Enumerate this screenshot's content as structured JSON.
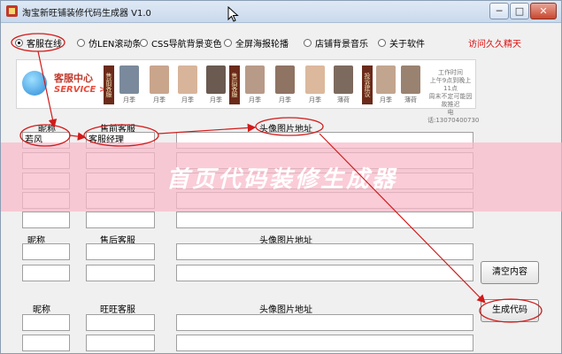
{
  "window": {
    "title": "淘宝新旺铺装修代码生成器 V1.0"
  },
  "titlebar_buttons": {
    "minimize": "─",
    "maximize": "□",
    "close": "✕"
  },
  "radios": [
    {
      "label": "客服在线",
      "selected": true
    },
    {
      "label": "仿LEN滚动条",
      "selected": false
    },
    {
      "label": "CSS导航背景变色",
      "selected": false
    },
    {
      "label": "全屏海报轮播",
      "selected": false
    },
    {
      "label": "店铺背景音乐",
      "selected": false
    },
    {
      "label": "关于软件",
      "selected": false
    }
  ],
  "visit_link": "访问久久精天",
  "preview": {
    "title": "客服中心",
    "subtitle": "SERVICE >",
    "presale_chip": "售前客服",
    "aftersale_chip": "售后客服",
    "consult_chip": "投诉建议",
    "avatar_labels": [
      "月季",
      "月季",
      "月季",
      "月季",
      "月季",
      "月季",
      "月季",
      "薄荷",
      "月季",
      "薄荷"
    ],
    "info_lines": [
      "工作时间",
      "上午9点到晚上11点",
      "周末不定可能因故推迟",
      "电话:13070400730"
    ]
  },
  "section1": {
    "nickname_header": "昵称",
    "role_header": "售前客服",
    "avatar_header": "头像图片地址",
    "rows": [
      {
        "nickname": "若风",
        "role": "客服经理",
        "avatar": ""
      },
      {
        "nickname": "",
        "role": "",
        "avatar": ""
      },
      {
        "nickname": "",
        "role": "",
        "avatar": ""
      },
      {
        "nickname": "",
        "role": "",
        "avatar": ""
      },
      {
        "nickname": "",
        "role": "",
        "avatar": ""
      }
    ]
  },
  "section2": {
    "nickname_header": "昵称",
    "role_header": "售后客服",
    "avatar_header": "头像图片地址"
  },
  "section3": {
    "nickname_header": "昵称",
    "role_header": "旺旺客服",
    "avatar_header": "头像图片地址"
  },
  "buttons": {
    "clear": "清空内容",
    "generate": "生成代码"
  },
  "banner": {
    "text": "首页代码装修生成器"
  },
  "colors": {
    "annotation_red": "#d11a1a",
    "banner_pink": "#f8b9c8",
    "link_red": "#dd1111"
  }
}
